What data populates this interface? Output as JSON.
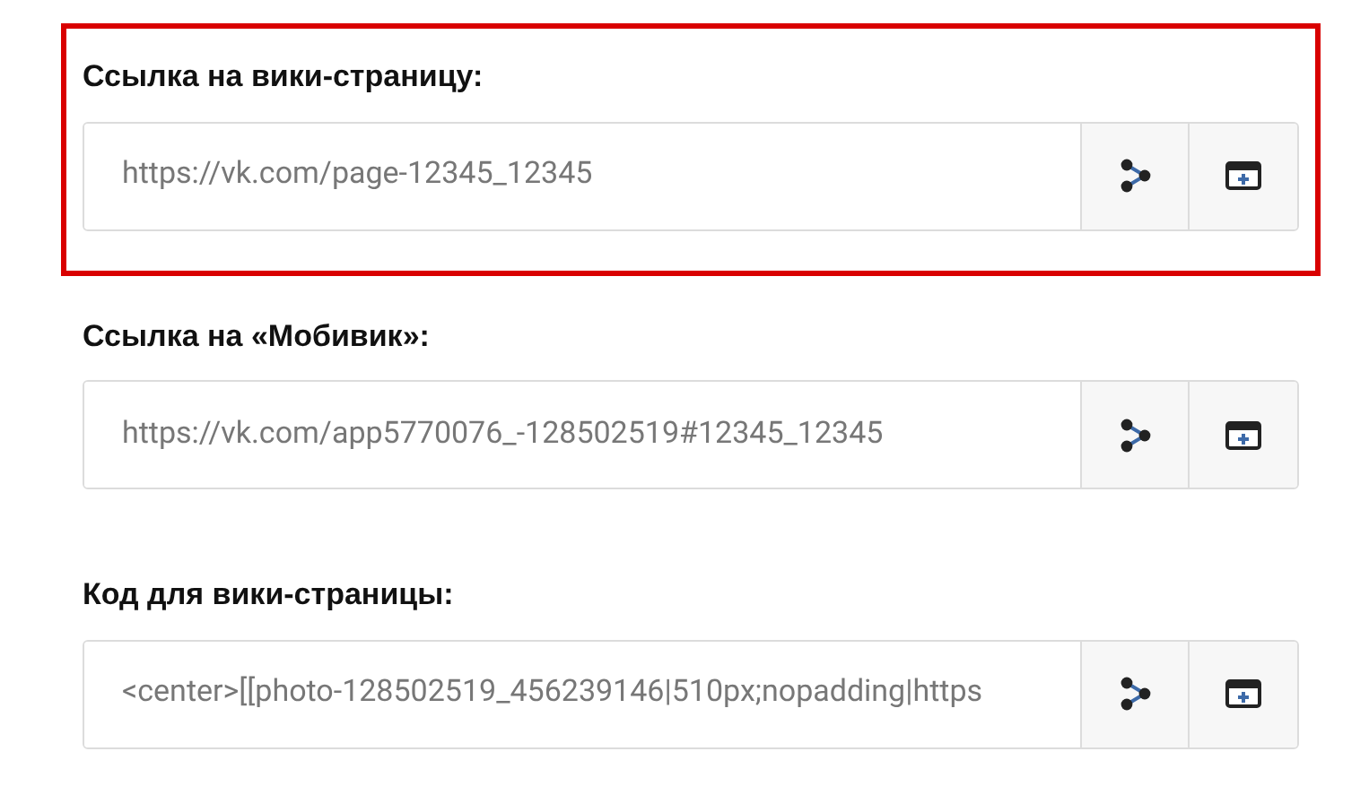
{
  "fields": [
    {
      "label": "Ссылка на вики-страницу:",
      "value": "https://vk.com/page-12345_12345",
      "highlighted": true
    },
    {
      "label": "Ссылка на «Мобивик»:",
      "value": "https://vk.com/app5770076_-128502519#12345_12345",
      "highlighted": false
    },
    {
      "label": "Код для вики-страницы:",
      "value": "<center>[[photo-128502519_456239146|510px;nopadding|https",
      "highlighted": false
    }
  ]
}
